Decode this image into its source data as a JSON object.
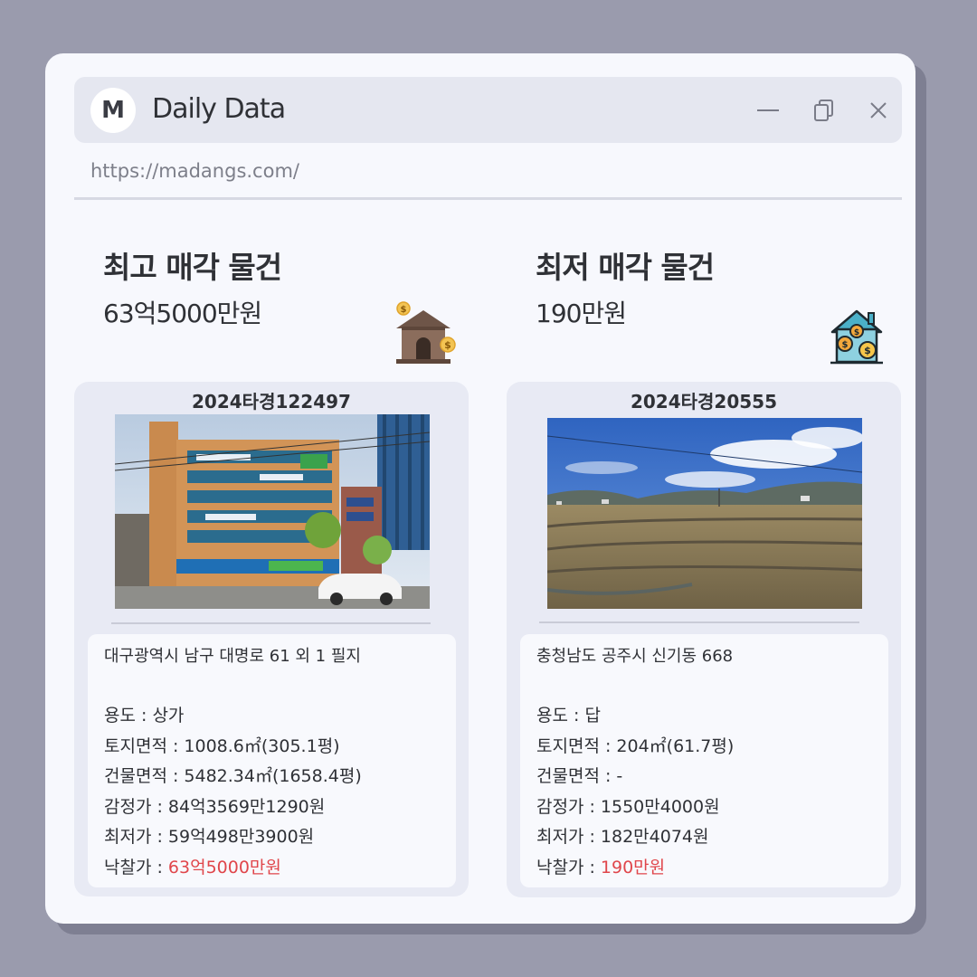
{
  "window": {
    "avatar_letter": "M",
    "title": "Daily Data",
    "url": "https://madangs.com/",
    "controls": [
      "minimize-icon",
      "restore-icon",
      "close-icon"
    ]
  },
  "left": {
    "heading": "최고 매각 물건",
    "price": "63억5000만원",
    "icon": "house-coin-icon",
    "case_no": "2024타경122497",
    "address": "대구광역시 남구 대명로 61 외 1 필지",
    "usage": "용도 : 상가",
    "land_area": "토지면적 : 1008.6㎡(305.1평)",
    "building_area": "건물면적 : 5482.34㎡(1658.4평)",
    "appraisal": "감정가 : 84억3569만1290원",
    "minimum": "최저가 : 59억498만3900원",
    "winning_label": "낙찰가 : ",
    "winning_value": "63억5000만원"
  },
  "right": {
    "heading": "최저 매각 물건",
    "price": "190만원",
    "icon": "house-money-icon",
    "case_no": "2024타경20555",
    "address": "충청남도 공주시 신기동 668",
    "usage": "용도 : 답",
    "land_area": "토지면적 : 204㎡(61.7평)",
    "building_area": "건물면적 : -",
    "appraisal": "감정가 : 1550만4000원",
    "minimum": "최저가 : 182만4074원",
    "winning_label": "낙찰가 : ",
    "winning_value": "190만원"
  },
  "colors": {
    "accent_red": "#e0464b",
    "background": "#9a9bad",
    "window": "#f7f8fd",
    "card": "#e8eaf4"
  }
}
